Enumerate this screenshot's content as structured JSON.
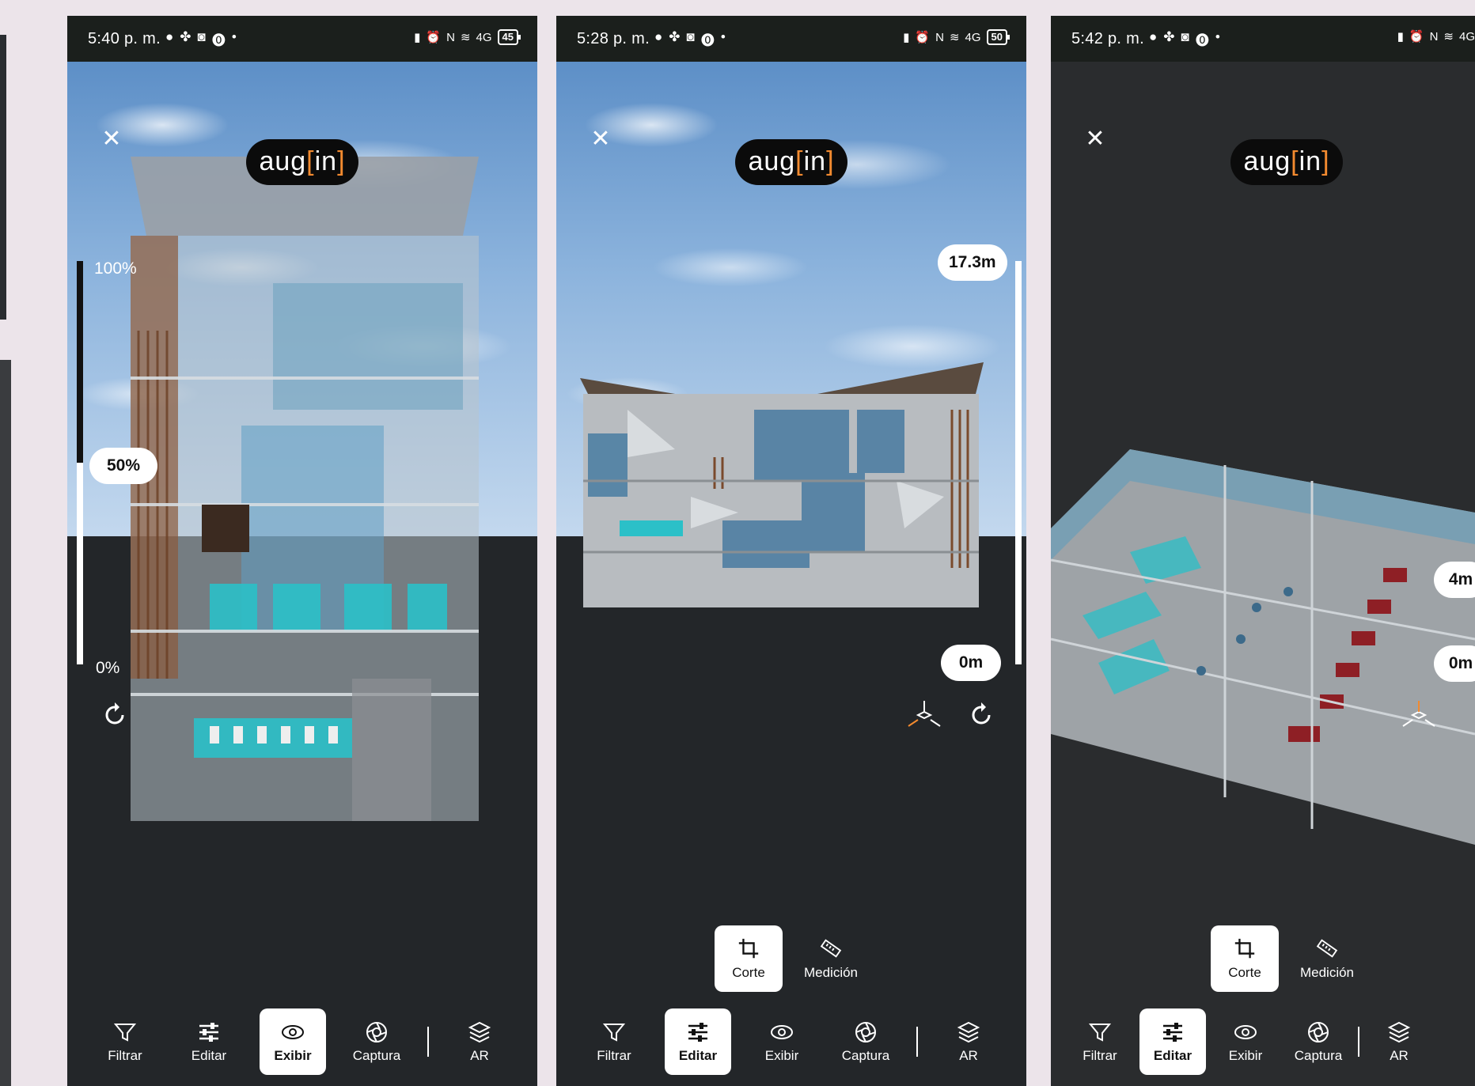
{
  "screens": [
    {
      "status": {
        "time": "5:40 p. m.",
        "battery": "45",
        "network": "4G"
      },
      "logo": {
        "text": "aug",
        "bracket": "[",
        "accent": "in",
        "bracket_close": "]"
      },
      "slider": {
        "top_label": "100%",
        "value_label": "50%",
        "bottom_label": "0%",
        "value": 0.5
      },
      "toolbar": [
        {
          "label": "Filtrar",
          "icon": "filter-icon",
          "active": false
        },
        {
          "label": "Editar",
          "icon": "sliders-icon",
          "active": false
        },
        {
          "label": "Exibir",
          "icon": "eye-icon",
          "active": true
        },
        {
          "label": "Captura",
          "icon": "camera-icon",
          "active": false
        },
        {
          "label": "AR",
          "icon": "layers-icon",
          "active": false
        }
      ]
    },
    {
      "status": {
        "time": "5:28 p. m.",
        "battery": "50",
        "network": "4G"
      },
      "logo": {
        "text": "aug",
        "bracket": "[",
        "accent": "in",
        "bracket_close": "]"
      },
      "height_max": "17.3m",
      "height_min": "0m",
      "subtools": [
        {
          "label": "Corte",
          "icon": "crop-icon",
          "active": true
        },
        {
          "label": "Medición",
          "icon": "ruler-icon",
          "active": false
        }
      ],
      "toolbar": [
        {
          "label": "Filtrar",
          "icon": "filter-icon",
          "active": false
        },
        {
          "label": "Editar",
          "icon": "sliders-icon",
          "active": true
        },
        {
          "label": "Exibir",
          "icon": "eye-icon",
          "active": false
        },
        {
          "label": "Captura",
          "icon": "camera-icon",
          "active": false
        },
        {
          "label": "AR",
          "icon": "layers-icon",
          "active": false
        }
      ]
    },
    {
      "status": {
        "time": "5:42 p. m.",
        "battery": "",
        "network": "4G"
      },
      "logo": {
        "text": "aug",
        "bracket": "[",
        "accent": "in",
        "bracket_close": "]"
      },
      "height_max": "4m",
      "height_min": "0m",
      "subtools": [
        {
          "label": "Corte",
          "icon": "crop-icon",
          "active": true
        },
        {
          "label": "Medición",
          "icon": "ruler-icon",
          "active": false
        }
      ],
      "toolbar": [
        {
          "label": "Filtrar",
          "icon": "filter-icon",
          "active": false
        },
        {
          "label": "Editar",
          "icon": "sliders-icon",
          "active": true
        },
        {
          "label": "Exibir",
          "icon": "eye-icon",
          "active": false
        },
        {
          "label": "Captura",
          "icon": "camera-icon",
          "active": false
        },
        {
          "label": "AR",
          "icon": "layers-icon",
          "active": false
        }
      ]
    }
  ],
  "colors": {
    "accent": "#f28a2f",
    "teal": "#2bc0c8",
    "panel": "#232629"
  }
}
